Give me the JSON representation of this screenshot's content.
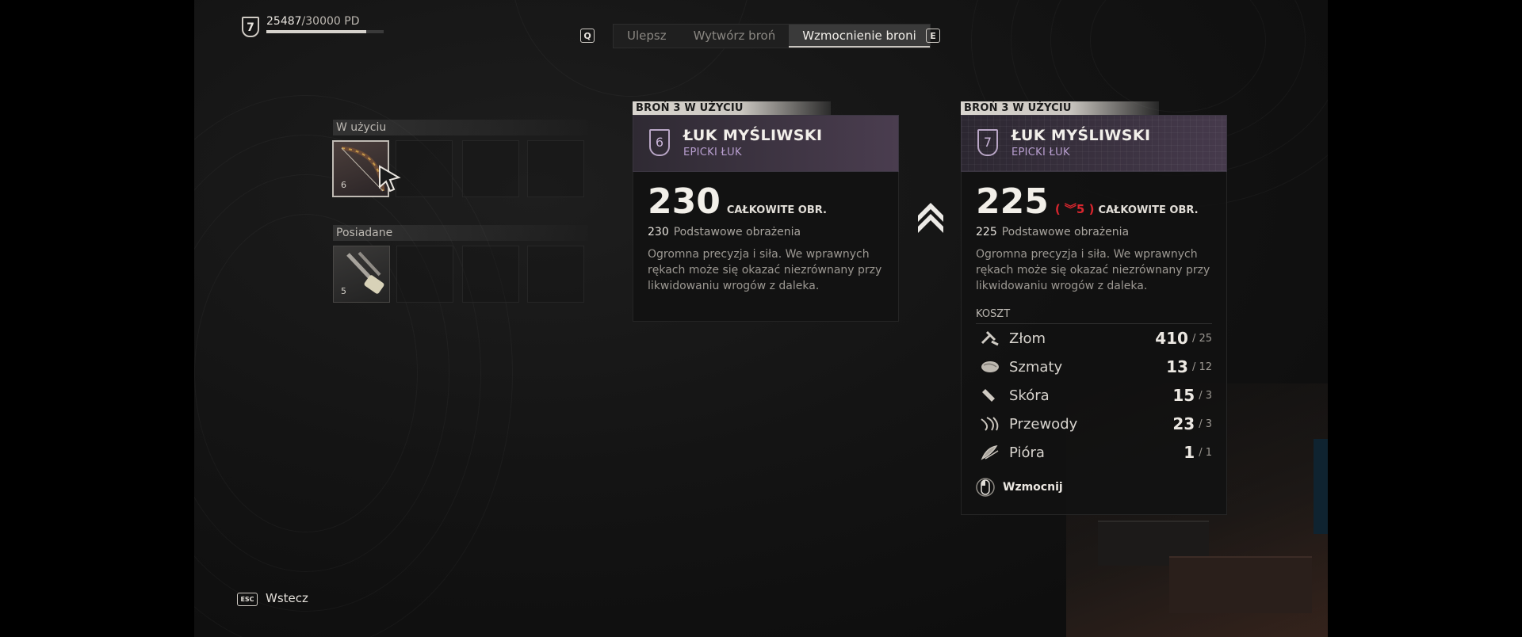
{
  "player": {
    "level": "7",
    "xp_current": "25487",
    "xp_max": "/30000 PD",
    "xp_progress": 0.85
  },
  "nav": {
    "key_prev": "Q",
    "key_next": "E",
    "tabs": [
      {
        "label": "Ulepsz",
        "active": false
      },
      {
        "label": "Wytwórz broń",
        "active": false
      },
      {
        "label": "Wzmocnienie broni",
        "active": true
      }
    ]
  },
  "inventory": {
    "equipped_label": "W użyciu",
    "owned_label": "Posiadane",
    "equipped_items": [
      {
        "icon": "hunting-bow-icon",
        "level": "6"
      }
    ],
    "owned_items": [
      {
        "icon": "melee-weapon-icon",
        "level": "5"
      }
    ]
  },
  "current_weapon": {
    "tag": "BROŃ 3 W UŻYCIU",
    "level": "6",
    "name": "ŁUK MYŚLIWSKI",
    "rarity": "EPICKI ŁUK",
    "total_damage": "230",
    "total_label": "CAŁKOWITE OBR.",
    "base_damage": "230",
    "base_label": "Podstawowe obrażenia",
    "description": "Ogromna precyzja i siła. We wprawnych rękach może się okazać niezrównany przy likwidowaniu wrogów z daleka."
  },
  "upgraded_weapon": {
    "tag": "BROŃ 3 W UŻYCIU",
    "level": "7",
    "name": "ŁUK MYŚLIWSKI",
    "rarity": "EPICKI ŁUK",
    "total_damage": "225",
    "damage_change": "( ︾5 )",
    "total_label": "CAŁKOWITE OBR.",
    "base_damage": "225",
    "base_label": "Podstawowe obrażenia",
    "description": "Ogromna precyzja i siła. We wprawnych rękach może się okazać niezrównany przy likwidowaniu wrogów z daleka.",
    "cost_title": "KOSZT",
    "costs": [
      {
        "icon": "scrap-icon",
        "name": "Złom",
        "have": "410",
        "need": "/ 25"
      },
      {
        "icon": "rags-icon",
        "name": "Szmaty",
        "have": "13",
        "need": "/ 12"
      },
      {
        "icon": "leather-icon",
        "name": "Skóra",
        "have": "15",
        "need": "/ 3"
      },
      {
        "icon": "wires-icon",
        "name": "Przewody",
        "have": "23",
        "need": "/ 3"
      },
      {
        "icon": "feathers-icon",
        "name": "Pióra",
        "have": "1",
        "need": "/ 1"
      }
    ],
    "action_label": "Wzmocnij"
  },
  "footer": {
    "key": "ESC",
    "back_label": "Wstecz"
  },
  "colors": {
    "negative": "#d8262e",
    "rarity_epic": "#b99fd0",
    "accent_light": "#d9d5cf"
  }
}
